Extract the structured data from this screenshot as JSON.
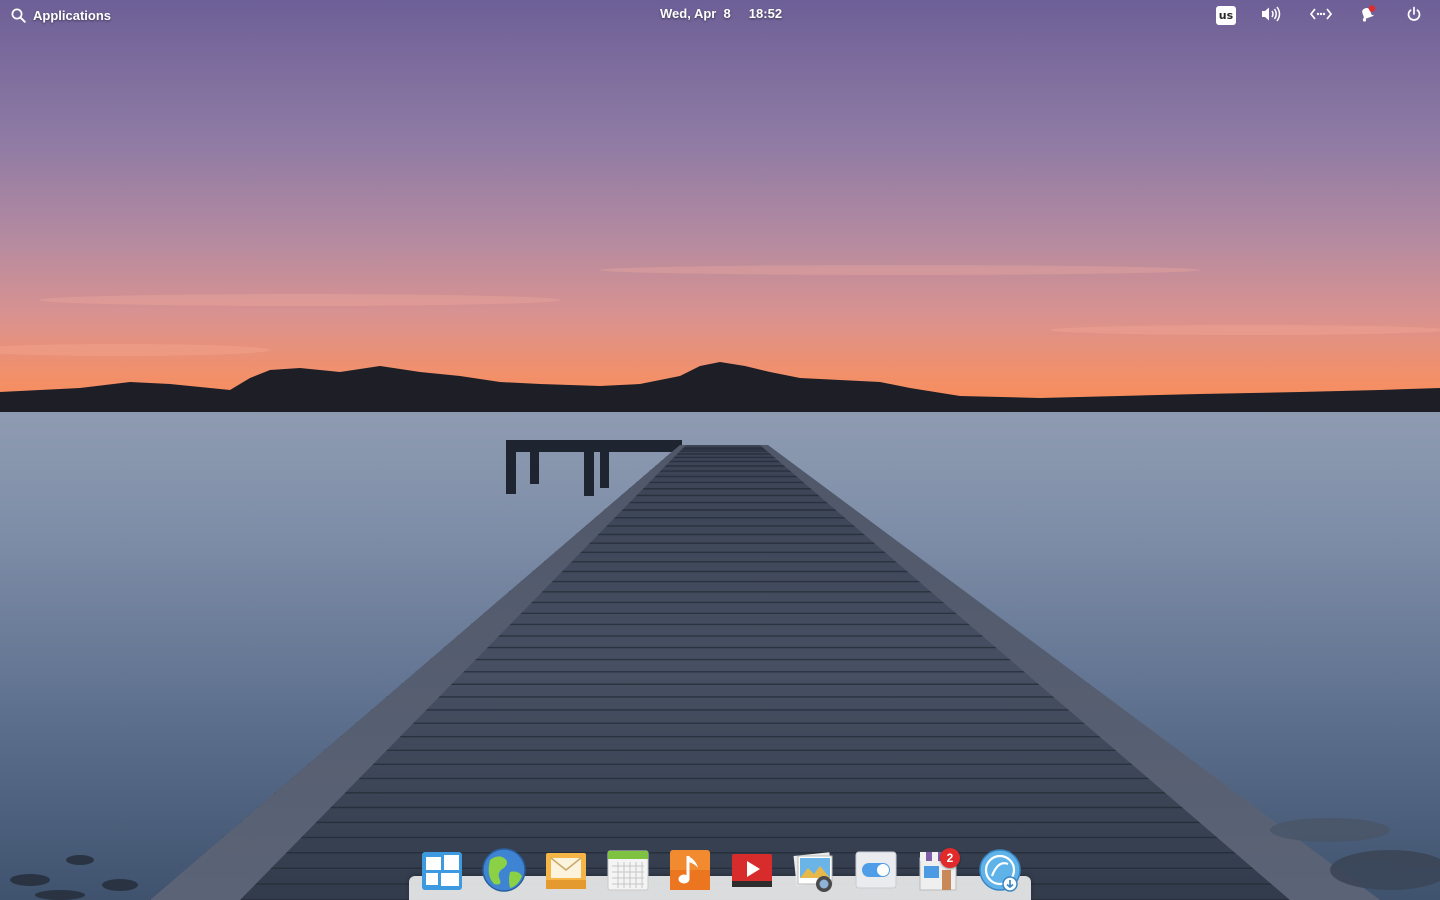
{
  "panel": {
    "applications_label": "Applications",
    "date": "Wed, Apr  8",
    "time": "18:52",
    "keyboard_layout": "us",
    "indicator_icons": [
      "keyboard-layout-icon",
      "volume-icon",
      "network-icon",
      "notifications-icon",
      "power-icon"
    ]
  },
  "dock": {
    "items": [
      {
        "icon": "multitasking-view-icon"
      },
      {
        "icon": "web-browser-icon"
      },
      {
        "icon": "mail-icon"
      },
      {
        "icon": "calendar-icon"
      },
      {
        "icon": "music-icon"
      },
      {
        "icon": "videos-icon"
      },
      {
        "icon": "photos-icon"
      },
      {
        "icon": "system-settings-icon"
      },
      {
        "icon": "appcenter-icon",
        "badge": "2"
      },
      {
        "icon": "installer-icon"
      }
    ]
  },
  "colors": {
    "badge": "#e12b2b",
    "dock_bg": "#e8e8e8"
  }
}
